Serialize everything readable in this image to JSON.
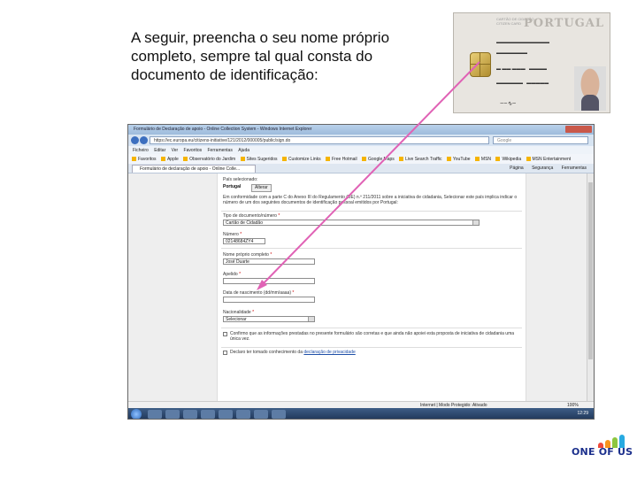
{
  "instruction": {
    "lines": [
      "A seguir, preencha o seu nome próprio",
      "completo,  sempre tal qual consta do",
      "documento de identificação:"
    ]
  },
  "id_card": {
    "country": "PORTUGAL"
  },
  "browser": {
    "window_title": "Formulário de Declaração de apoio - Online Collection System - Windows Internet Explorer",
    "url": "https://ec.europa.eu/citizens-initiative/121/2012/000005/public/sign.do",
    "search_placeholder": "Google",
    "menu": [
      "Ficheiro",
      "Editar",
      "Ver",
      "Favoritos",
      "Ferramentas",
      "Ajuda"
    ],
    "favorites": [
      "Favoritos",
      "Apple",
      "Observatório do Jardim",
      "Sites Sugeridos",
      "Customize Links",
      "Free Hotmail",
      "Google Maps",
      "Live Search Traffic",
      "YouTube",
      "MSN",
      "Wikipedia",
      "MSN Entertainment"
    ],
    "tab_label": "Formulário de declaração de apoio - Online Colle...",
    "tools": [
      "Página",
      "Segurança",
      "Ferramentas"
    ]
  },
  "form": {
    "country_label": "País selecionado:",
    "country_value": "Portugal",
    "change_button": "Alterar",
    "intro_text": "Em conformidade com a parte C do Anexo III do Regulamento (UE) n.º 211/2011 sobre a iniciativa de cidadania, Selecionar este país implica indicar o número de um dos seguintes documentos de identificação pessoal emitidos por Portugal:",
    "doc_type_label": "Tipo de documento/número",
    "doc_type_value": "Cartão de Cidadão",
    "number_label": "Número",
    "number_value": "02148684ZY4",
    "first_name_label": "Nome próprio completo",
    "first_name_value": "José Duarte",
    "surname_label": "Apelido",
    "dob_label": "Data de nascimento (dd/mm/aaaa)",
    "nationality_label": "Nacionalidade",
    "nationality_value": "Selecionar",
    "required_mark": "*",
    "confirm_text": "Confirmo que as informações prestadas no presente formulário são corretas e que ainda não apoiei esta proposta de iniciativa de cidadania uma única vez.",
    "privacy_text": "Declaro ter tomado conhecimento da",
    "privacy_link": "declaração de privacidade"
  },
  "status": {
    "zone": "Internet | Modo Protegido: Ativado",
    "zoom": "100%",
    "clock": "12:29"
  },
  "logo": {
    "name": "ONE OF US"
  },
  "colors": {
    "arrow": "#e062b5",
    "logo_text": "#1b2f8c"
  }
}
